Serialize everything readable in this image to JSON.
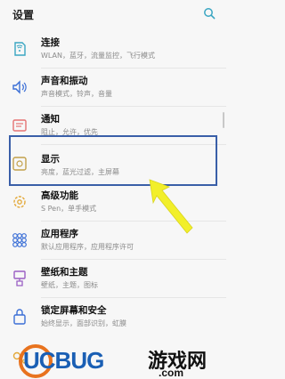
{
  "header": {
    "title": "设置"
  },
  "items": [
    {
      "name": "连接",
      "sub": "WLAN，蓝牙，流量监控，飞行模式",
      "icon": "connection-icon"
    },
    {
      "name": "声音和振动",
      "sub": "声音模式，铃声，音量",
      "icon": "sound-icon"
    },
    {
      "name": "通知",
      "sub": "阻止，允许，优先",
      "icon": "notification-icon"
    },
    {
      "name": "显示",
      "sub": "亮度，蓝光过滤，主屏幕",
      "icon": "display-icon"
    },
    {
      "name": "高级功能",
      "sub": "S Pen，单手模式",
      "icon": "advanced-features-icon"
    },
    {
      "name": "应用程序",
      "sub": "默认应用程序，应用程序许可",
      "icon": "apps-icon"
    },
    {
      "name": "壁纸和主题",
      "sub": "壁纸，主题，图标",
      "icon": "wallpaper-icon"
    },
    {
      "name": "锁定屏幕和安全",
      "sub": "始终显示，面部识别，虹膜",
      "icon": "lock-screen-icon"
    },
    {
      "name": "",
      "sub": "",
      "icon": "key-icon"
    }
  ],
  "colors": {
    "accent": "#3a5fa8",
    "icon_teal": "#3aa6c2",
    "icon_blue": "#3b6fd6",
    "icon_orange": "#e3a93a",
    "icon_purple": "#9a5fc4",
    "arrow": "#f2ef2a"
  },
  "watermark": {
    "brand_ucbug": "UCBUG",
    "brand_cn": "游戏网",
    "domain": ".com"
  }
}
